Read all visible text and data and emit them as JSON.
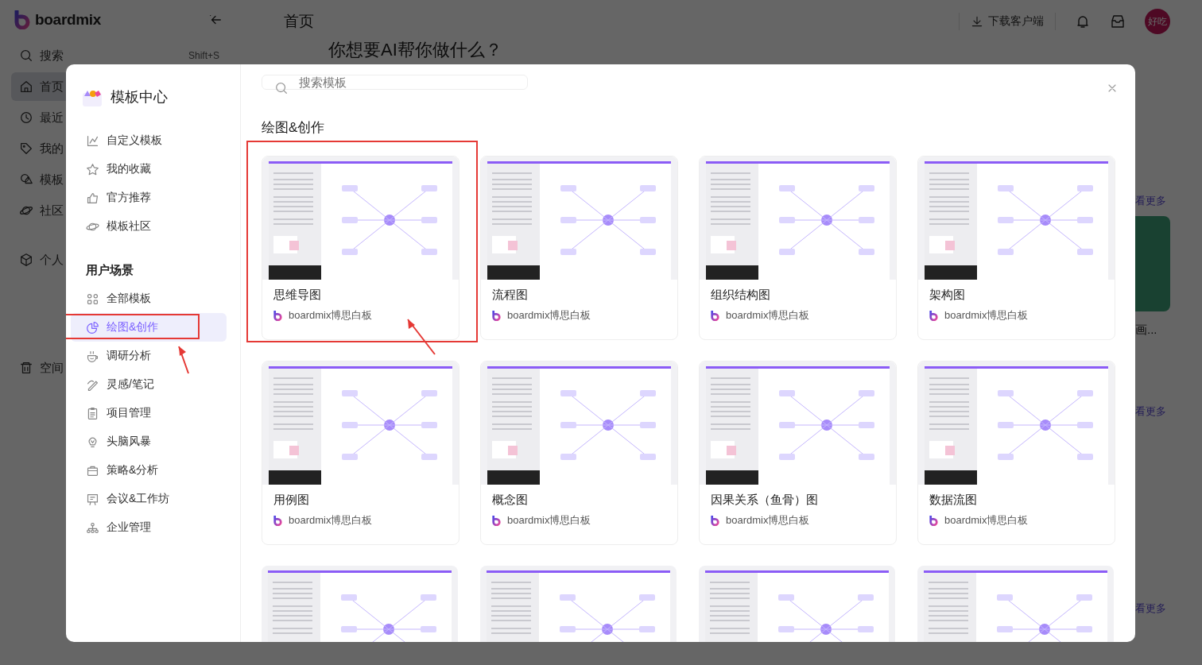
{
  "app": {
    "logo": "boardmix",
    "nav_groups": [
      [
        {
          "label": "搜索",
          "shortcut": "Shift+S",
          "selected": false
        },
        {
          "label": "首页",
          "selected": true
        },
        {
          "label": "最近",
          "selected": false
        },
        {
          "label": "我的",
          "selected": false
        },
        {
          "label": "模板",
          "selected": false
        },
        {
          "label": "社区",
          "selected": false
        }
      ],
      [
        {
          "label": "个人",
          "selected": false
        }
      ],
      [
        {
          "label": "空间",
          "selected": false
        }
      ]
    ],
    "header": {
      "title": "首页",
      "download": "下载客户端",
      "avatar": "好吃"
    },
    "hero": "你想要AI帮你做什么？",
    "side_content": {
      "more_links": [
        "看更多",
        "看更多",
        "看更多"
      ],
      "card_title": "画..."
    }
  },
  "modal": {
    "title": "模板中心",
    "quick_links": [
      {
        "label": "自定义模板"
      },
      {
        "label": "我的收藏"
      },
      {
        "label": "官方推荐"
      },
      {
        "label": "模板社区"
      }
    ],
    "section": "用户场景",
    "scenes": [
      {
        "label": "全部模板",
        "selected": false,
        "highlighted": false
      },
      {
        "label": "绘图&创作",
        "selected": true,
        "highlighted": true
      },
      {
        "label": "调研分析",
        "selected": false,
        "highlighted": false
      },
      {
        "label": "灵感/笔记",
        "selected": false,
        "highlighted": false
      },
      {
        "label": "项目管理",
        "selected": false,
        "highlighted": false
      },
      {
        "label": "头脑风暴",
        "selected": false,
        "highlighted": false
      },
      {
        "label": "策略&分析",
        "selected": false,
        "highlighted": false
      },
      {
        "label": "会议&工作坊",
        "selected": false,
        "highlighted": false
      },
      {
        "label": "企业管理",
        "selected": false,
        "highlighted": false
      }
    ],
    "search": {
      "placeholder": "搜索模板"
    },
    "heading": "绘图&创作",
    "cards": [
      {
        "kind": "full",
        "title": "思维导图",
        "author": "boardmix博思白板",
        "highlighted": true
      },
      {
        "kind": "full",
        "title": "流程图",
        "author": "boardmix博思白板",
        "highlighted": false
      },
      {
        "kind": "full",
        "title": "组织结构图",
        "author": "boardmix博思白板",
        "highlighted": false
      },
      {
        "kind": "full",
        "title": "架构图",
        "author": "boardmix博思白板",
        "highlighted": false
      },
      {
        "kind": "full",
        "title": "用例图",
        "author": "boardmix博思白板",
        "highlighted": false
      },
      {
        "kind": "full",
        "title": "概念图",
        "author": "boardmix博思白板",
        "highlighted": false
      },
      {
        "kind": "full",
        "title": "因果关系（鱼骨）图",
        "author": "boardmix博思白板",
        "highlighted": false
      },
      {
        "kind": "full",
        "title": "数据流图",
        "author": "boardmix博思白板",
        "highlighted": false
      },
      {
        "kind": "preview_only"
      },
      {
        "kind": "preview_only"
      },
      {
        "kind": "preview_only"
      },
      {
        "kind": "preview_only"
      }
    ]
  }
}
